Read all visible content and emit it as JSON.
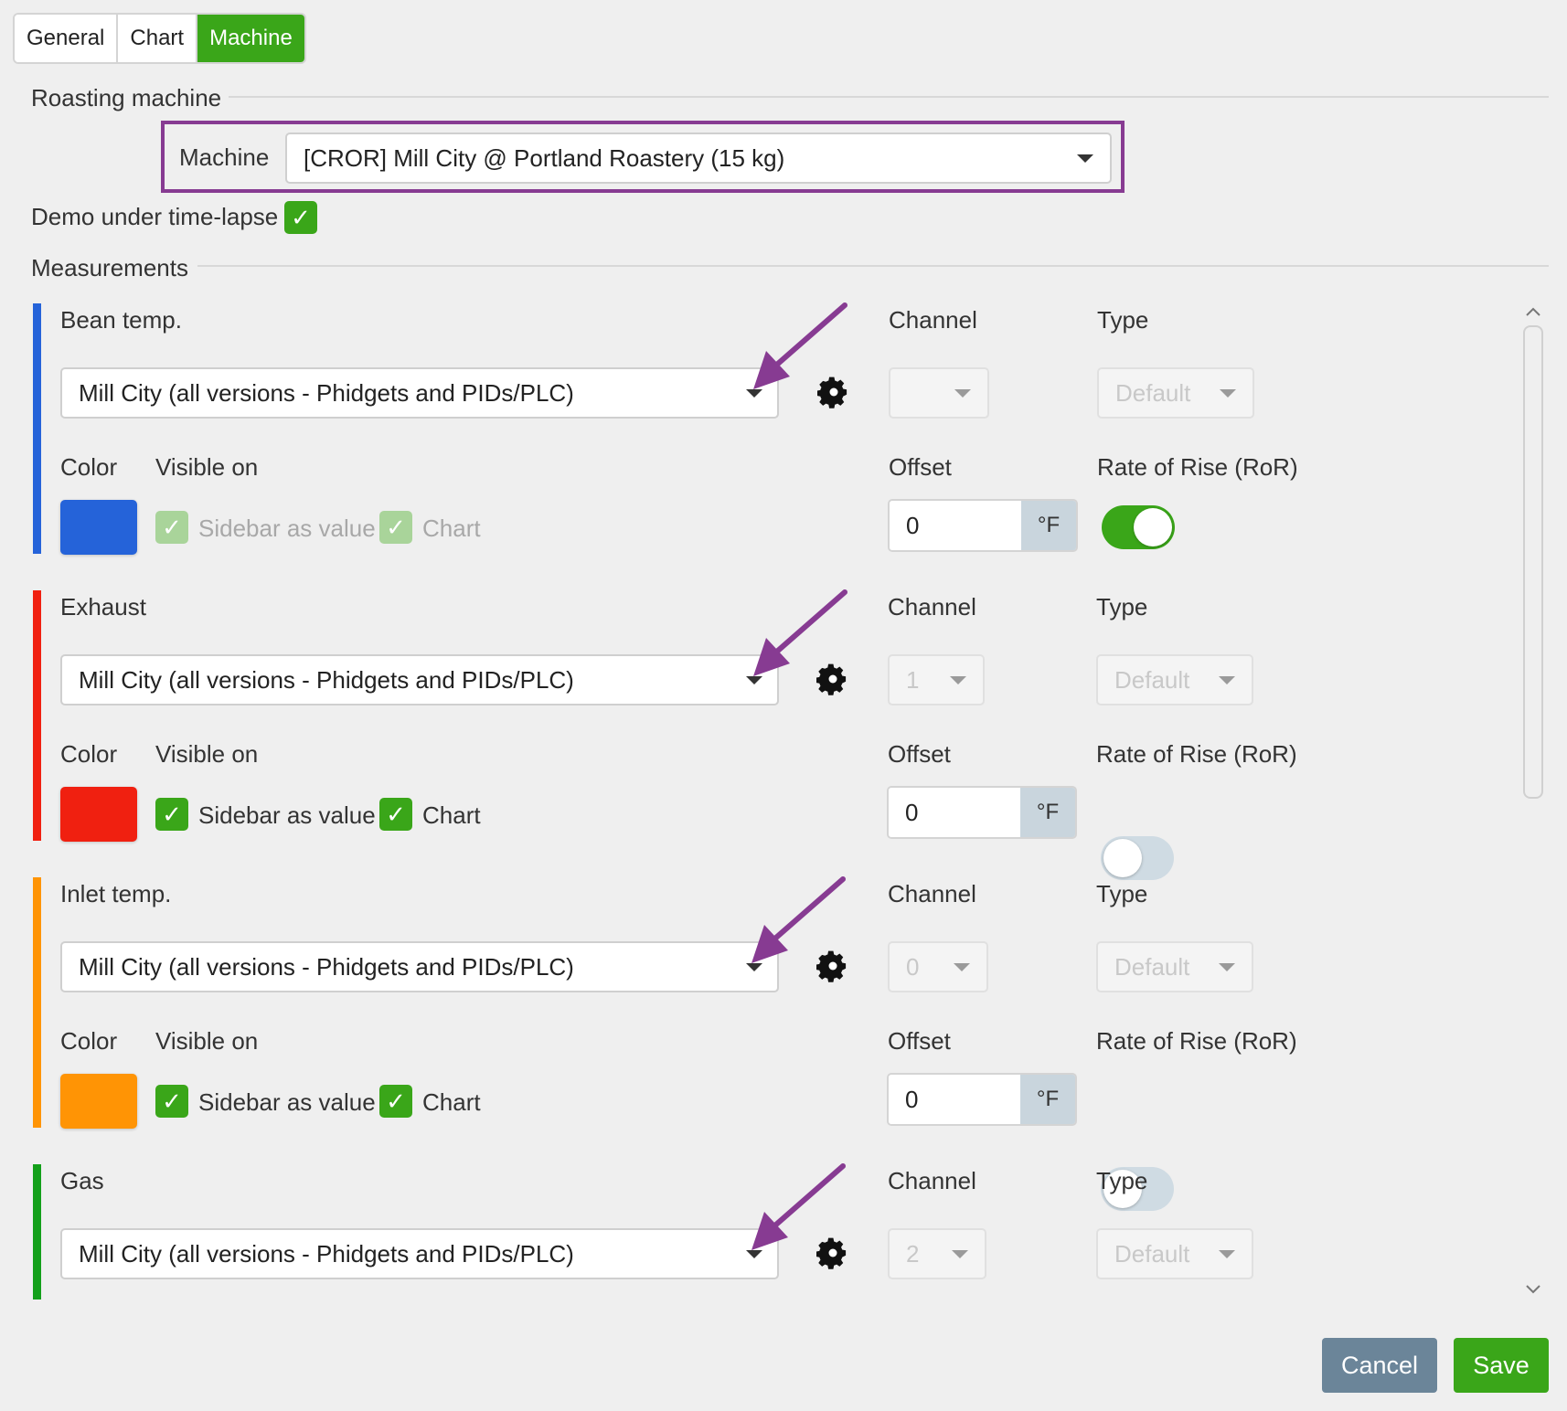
{
  "tabs": [
    {
      "label": "General",
      "active": false
    },
    {
      "label": "Chart",
      "active": false
    },
    {
      "label": "Machine",
      "active": true
    }
  ],
  "roasting_machine": {
    "section_title": "Roasting machine",
    "machine_label": "Machine",
    "machine_value": "[CROR] Mill City @ Portland Roastery (15 kg)",
    "highlight_color": "#873b92"
  },
  "demo": {
    "label": "Demo under time-lapse",
    "checked": true
  },
  "measurements": {
    "section_title": "Measurements",
    "items": [
      {
        "name": "Bean temp.",
        "color": "#2563d9",
        "source": "Mill City (all versions - Phidgets and PIDs/PLC)",
        "channel_label": "Channel",
        "channel_value": "",
        "type_label": "Type",
        "type_value": "Default",
        "color_label": "Color",
        "visible_on_label": "Visible on",
        "sidebar_label": "Sidebar as value",
        "sidebar_checked": true,
        "chart_label": "Chart",
        "chart_checked": true,
        "visibility_disabled": true,
        "offset_label": "Offset",
        "offset_value": "0",
        "offset_unit": "°F",
        "ror_label": "Rate of Rise (RoR)",
        "ror_on": true
      },
      {
        "name": "Exhaust",
        "color": "#f02010",
        "source": "Mill City (all versions - Phidgets and PIDs/PLC)",
        "channel_label": "Channel",
        "channel_value": "1",
        "type_label": "Type",
        "type_value": "Default",
        "color_label": "Color",
        "visible_on_label": "Visible on",
        "sidebar_label": "Sidebar as value",
        "sidebar_checked": true,
        "chart_label": "Chart",
        "chart_checked": true,
        "visibility_disabled": false,
        "offset_label": "Offset",
        "offset_value": "0",
        "offset_unit": "°F",
        "ror_label": "Rate of Rise (RoR)",
        "ror_on": false
      },
      {
        "name": "Inlet temp.",
        "color": "#ff9405",
        "source": "Mill City (all versions - Phidgets and PIDs/PLC)",
        "channel_label": "Channel",
        "channel_value": "0",
        "type_label": "Type",
        "type_value": "Default",
        "color_label": "Color",
        "visible_on_label": "Visible on",
        "sidebar_label": "Sidebar as value",
        "sidebar_checked": true,
        "chart_label": "Chart",
        "chart_checked": true,
        "visibility_disabled": false,
        "offset_label": "Offset",
        "offset_value": "0",
        "offset_unit": "°F",
        "ror_label": "Rate of Rise (RoR)",
        "ror_on": false
      },
      {
        "name": "Gas",
        "color": "#13a01a",
        "source": "Mill City (all versions - Phidgets and PIDs/PLC)",
        "channel_label": "Channel",
        "channel_value": "2",
        "type_label": "Type",
        "type_value": "Default"
      }
    ]
  },
  "annotation_arrow_color": "#873b92",
  "buttons": {
    "cancel": "Cancel",
    "save": "Save"
  }
}
